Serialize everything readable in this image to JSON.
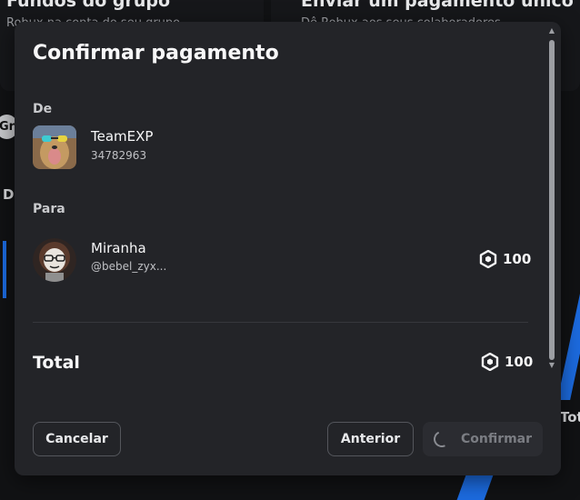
{
  "background": {
    "card_left_title": "Fundos do grupo",
    "card_left_sub": "Robux na conta do seu grupo",
    "card_right_title": "Enviar um pagamento único",
    "card_right_sub": "Dê Robux aos seus colaboradores",
    "chip_label": "Gr",
    "left_text": "Di",
    "right_text": "Tot"
  },
  "modal": {
    "title": "Confirmar pagamento",
    "from_label": "De",
    "from_name": "TeamEXP",
    "from_id": "34782963",
    "to_label": "Para",
    "to_name": "Miranha",
    "to_username": "@bebel_zyx...",
    "to_amount": "100",
    "total_label": "Total",
    "total_amount": "100",
    "cancel_label": "Cancelar",
    "previous_label": "Anterior",
    "confirm_label": "Confirmar"
  },
  "colors": {
    "modal_bg": "#232428",
    "page_bg": "#111214",
    "accent_stripe": "#1c6be0"
  },
  "icons": {
    "currency": "robux-icon",
    "loading": "spinner-icon"
  }
}
